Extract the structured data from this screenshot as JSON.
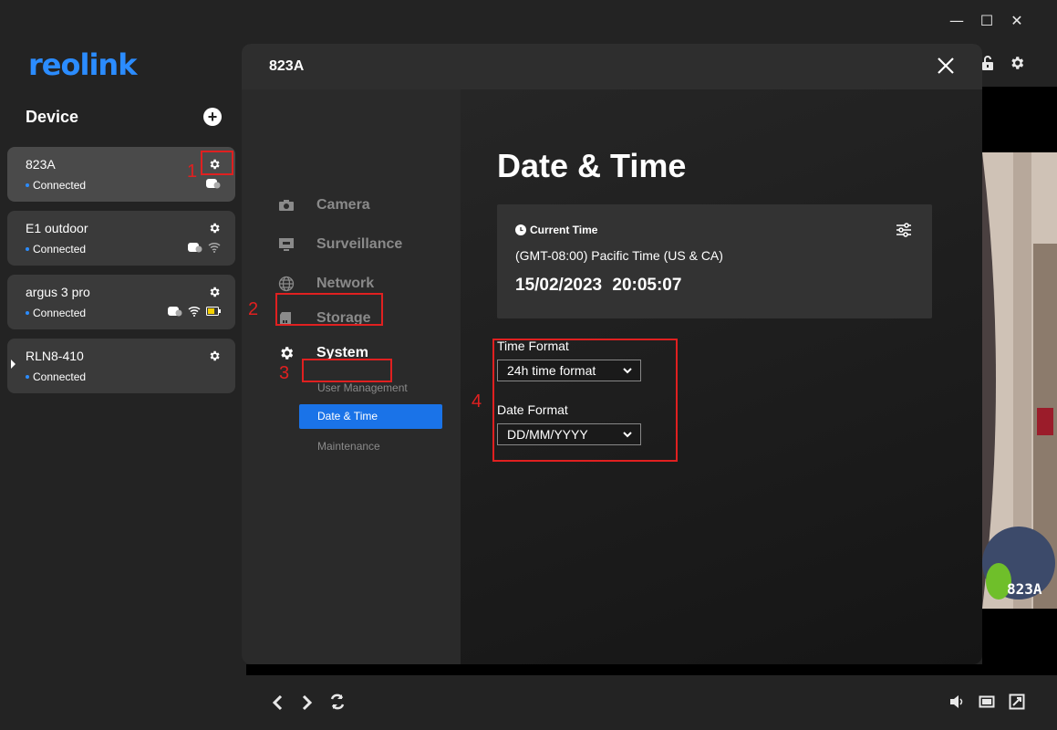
{
  "app": {
    "logo": "reolink",
    "window_controls": {
      "minimize": "—",
      "maximize": "☐",
      "close": "✕"
    }
  },
  "sidebar": {
    "title": "Device",
    "devices": [
      {
        "name": "823A",
        "status": "Connected"
      },
      {
        "name": "E1 outdoor",
        "status": "Connected"
      },
      {
        "name": "argus 3 pro",
        "status": "Connected"
      },
      {
        "name": "RLN8-410",
        "status": "Connected"
      }
    ]
  },
  "modal": {
    "title": "823A",
    "nav": {
      "camera": "Camera",
      "surveillance": "Surveillance",
      "network": "Network",
      "storage": "Storage",
      "system": "System",
      "sub": {
        "user_management": "User Management",
        "date_time": "Date & Time",
        "maintenance": "Maintenance"
      }
    },
    "content": {
      "page_title": "Date & Time",
      "current_time_label": "Current Time",
      "timezone": "(GMT-08:00) Pacific Time (US & CA)",
      "datetime": "15/02/2023  20:05:07",
      "time_format_label": "Time Format",
      "time_format_value": "24h time format",
      "date_format_label": "Date Format",
      "date_format_value": "DD/MM/YYYY"
    }
  },
  "annotations": {
    "n1": "1",
    "n2": "2",
    "n3": "3",
    "n4": "4",
    "color": "#e02020"
  },
  "video": {
    "label": "823A"
  },
  "colors": {
    "accent": "#1a73e8",
    "logo": "#2b8cff",
    "status_dot": "#2b8cff"
  }
}
